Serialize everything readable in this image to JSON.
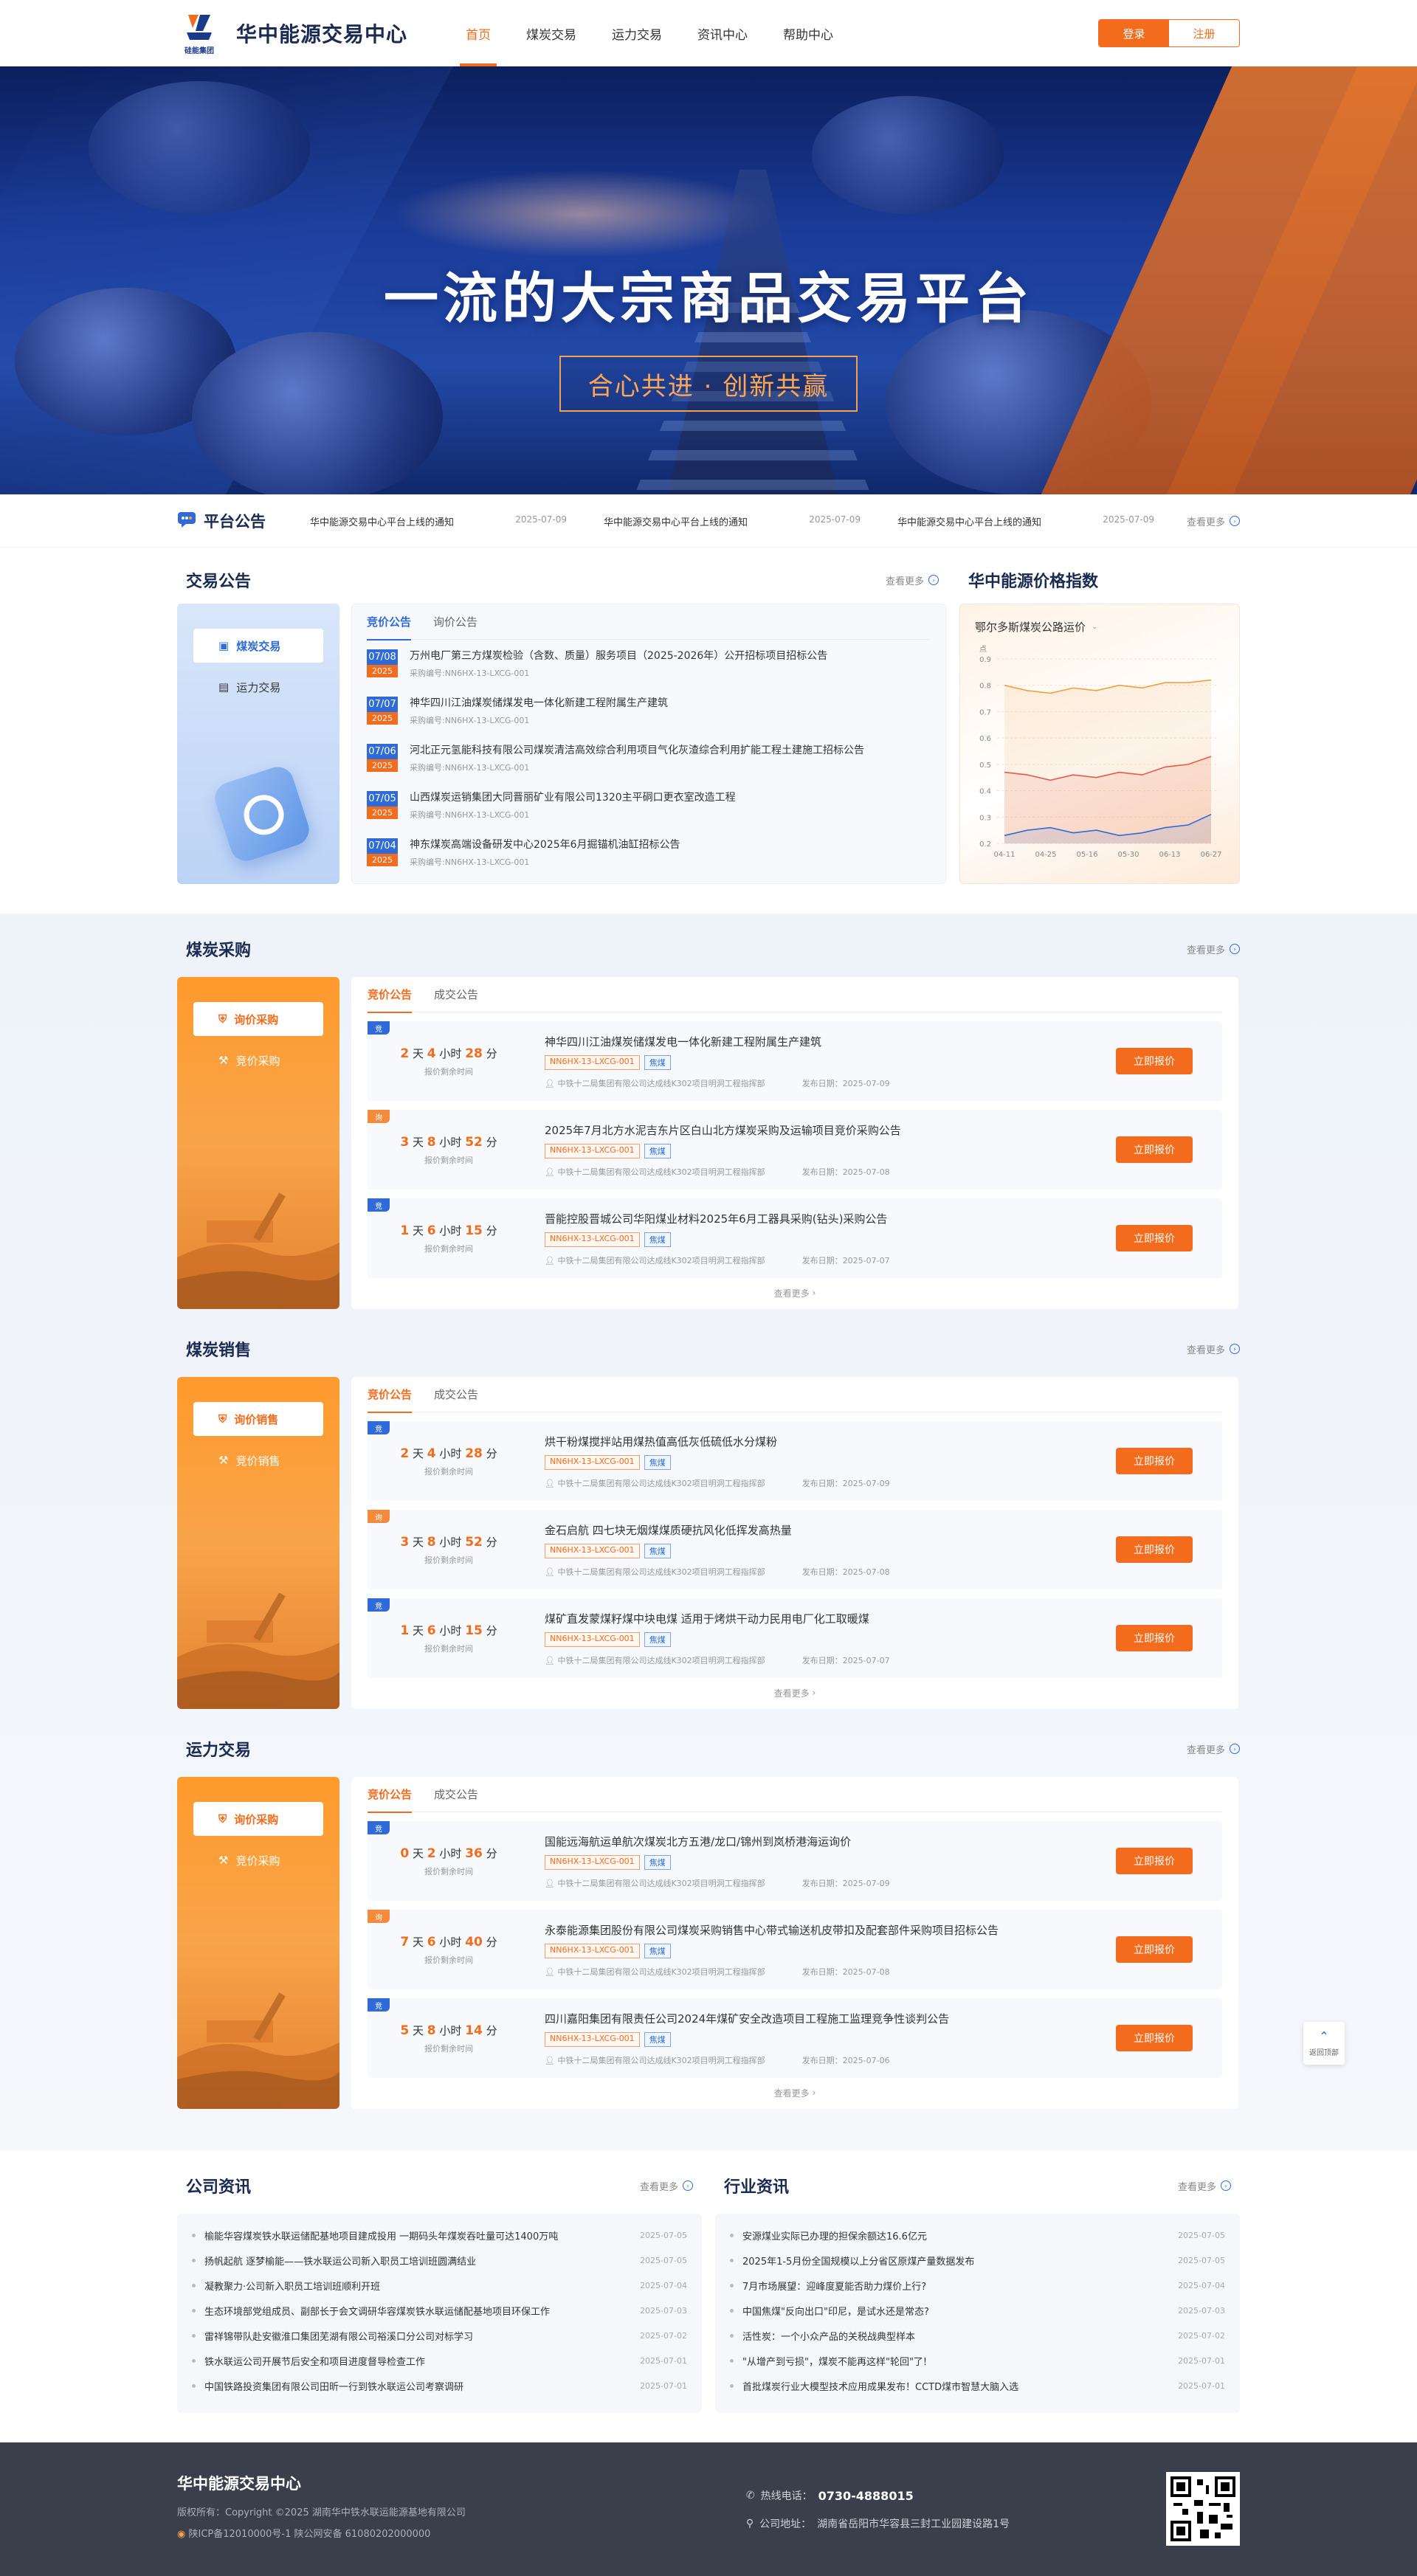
{
  "header": {
    "logo_sub": "硅能集团",
    "site_title": "华中能源交易中心",
    "nav": [
      {
        "label": "首页",
        "active": true
      },
      {
        "label": "煤炭交易"
      },
      {
        "label": "运力交易"
      },
      {
        "label": "资讯中心"
      },
      {
        "label": "帮助中心"
      }
    ],
    "login": "登录",
    "register": "注册"
  },
  "banner": {
    "title": "一流的大宗商品交易平台",
    "slogan": "合心共进 · 创新共赢"
  },
  "platform_notice": {
    "title": "平台公告",
    "items": [
      {
        "text": "华中能源交易中心平台上线的通知",
        "date": "2025-07-09"
      },
      {
        "text": "华中能源交易中心平台上线的通知",
        "date": "2025-07-09"
      },
      {
        "text": "华中能源交易中心平台上线的通知",
        "date": "2025-07-09"
      }
    ],
    "more": "查看更多"
  },
  "trade_announce": {
    "title": "交易公告",
    "more": "查看更多",
    "side": [
      "煤炭交易",
      "运力交易"
    ],
    "tabs": [
      "竞价公告",
      "询价公告"
    ],
    "items": [
      {
        "md": "07/08",
        "yr": "2025",
        "title": "万州电厂第三方煤炭检验（含数、质量）服务项目（2025-2026年）公开招标项目招标公告",
        "no": "采购编号:NN6HX-13-LXCG-001"
      },
      {
        "md": "07/07",
        "yr": "2025",
        "title": "神华四川江油煤炭储煤发电一体化新建工程附属生产建筑",
        "no": "采购编号:NN6HX-13-LXCG-001"
      },
      {
        "md": "07/06",
        "yr": "2025",
        "title": "河北正元氢能科技有限公司煤炭清洁高效综合利用项目气化灰渣综合利用扩能工程土建施工招标公告",
        "no": "采购编号:NN6HX-13-LXCG-001"
      },
      {
        "md": "07/05",
        "yr": "2025",
        "title": "山西煤炭运销集团大同晋丽矿业有限公司1320主平硐口更衣室改造工程",
        "no": "采购编号:NN6HX-13-LXCG-001"
      },
      {
        "md": "07/04",
        "yr": "2025",
        "title": "神东煤炭高端设备研发中心2025年6月掘锚机油缸招标公告",
        "no": "采购编号:NN6HX-13-LXCG-001"
      }
    ]
  },
  "price_index": {
    "title": "华中能源价格指数",
    "select": "鄂尔多斯煤炭公路运价"
  },
  "chart_data": {
    "type": "line",
    "title": "",
    "ylabel": "点",
    "x": [
      "04-11",
      "04-25",
      "05-16",
      "05-30",
      "06-13",
      "06-27"
    ],
    "ylim": [
      0.2,
      0.9
    ],
    "yticks": [
      0.2,
      0.3,
      0.4,
      0.5,
      0.6,
      0.7,
      0.8,
      0.9
    ],
    "series": [
      {
        "color": "#f0a040",
        "values": [
          0.8,
          0.78,
          0.77,
          0.79,
          0.78,
          0.8,
          0.79,
          0.81,
          0.81,
          0.82
        ]
      },
      {
        "color": "#e85a4a",
        "values": [
          0.47,
          0.46,
          0.44,
          0.46,
          0.45,
          0.47,
          0.46,
          0.49,
          0.5,
          0.53
        ]
      },
      {
        "color": "#2f6bd8",
        "values": [
          0.23,
          0.25,
          0.26,
          0.24,
          0.25,
          0.23,
          0.24,
          0.26,
          0.27,
          0.31
        ]
      }
    ]
  },
  "coal_purchase": {
    "title": "煤炭采购",
    "more": "查看更多",
    "side": [
      "询价采购",
      "竞价采购"
    ],
    "tabs": [
      "竞价公告",
      "成交公告"
    ],
    "rows": [
      {
        "flag": "竞",
        "flag_color": "blue",
        "d": "2",
        "h": "4",
        "m": "28",
        "title": "神华四川江油煤炭储煤发电一体化新建工程附属生产建筑",
        "code": "NN6HX-13-LXCG-001",
        "kind": "焦煤",
        "org": "中铁十二局集团有限公司达成线K302项目明洞工程指挥部",
        "date": "发布日期：2025-07-09"
      },
      {
        "flag": "询",
        "flag_color": "orange",
        "d": "3",
        "h": "8",
        "m": "52",
        "title": "2025年7月北方水泥吉东片区白山北方煤炭采购及运输项目竞价采购公告",
        "code": "NN6HX-13-LXCG-001",
        "kind": "焦煤",
        "org": "中铁十二局集团有限公司达成线K302项目明洞工程指挥部",
        "date": "发布日期：2025-07-08"
      },
      {
        "flag": "竞",
        "flag_color": "blue",
        "d": "1",
        "h": "6",
        "m": "15",
        "title": "晋能控股晋城公司华阳煤业材料2025年6月工器具采购(钻头)采购公告",
        "code": "NN6HX-13-LXCG-001",
        "kind": "焦煤",
        "org": "中铁十二局集团有限公司达成线K302项目明洞工程指挥部",
        "date": "发布日期：2025-07-07"
      }
    ]
  },
  "coal_sale": {
    "title": "煤炭销售",
    "more": "查看更多",
    "side": [
      "询价销售",
      "竞价销售"
    ],
    "tabs": [
      "竞价公告",
      "成交公告"
    ],
    "rows": [
      {
        "flag": "竞",
        "flag_color": "blue",
        "d": "2",
        "h": "4",
        "m": "28",
        "title": "烘干粉煤搅拌站用煤热值高低灰低硫低水分煤粉",
        "code": "NN6HX-13-LXCG-001",
        "kind": "焦煤",
        "org": "中铁十二局集团有限公司达成线K302项目明洞工程指挥部",
        "date": "发布日期：2025-07-09"
      },
      {
        "flag": "询",
        "flag_color": "orange",
        "d": "3",
        "h": "8",
        "m": "52",
        "title": "金石启航 四七块无烟煤煤质硬抗风化低挥发高热量",
        "code": "NN6HX-13-LXCG-001",
        "kind": "焦煤",
        "org": "中铁十二局集团有限公司达成线K302项目明洞工程指挥部",
        "date": "发布日期：2025-07-08"
      },
      {
        "flag": "竞",
        "flag_color": "blue",
        "d": "1",
        "h": "6",
        "m": "15",
        "title": "煤矿直发蒙煤籽煤中块电煤 适用于烤烘干动力民用电厂化工取暖煤",
        "code": "NN6HX-13-LXCG-001",
        "kind": "焦煤",
        "org": "中铁十二局集团有限公司达成线K302项目明洞工程指挥部",
        "date": "发布日期：2025-07-07"
      }
    ]
  },
  "capacity": {
    "title": "运力交易",
    "more": "查看更多",
    "side": [
      "询价采购",
      "竞价采购"
    ],
    "tabs": [
      "竞价公告",
      "成交公告"
    ],
    "rows": [
      {
        "flag": "竞",
        "flag_color": "blue",
        "d": "0",
        "h": "2",
        "m": "36",
        "title": "国能远海航运单航次煤炭北方五港/龙口/锦州到岚桥港海运询价",
        "code": "NN6HX-13-LXCG-001",
        "kind": "焦煤",
        "org": "中铁十二局集团有限公司达成线K302项目明洞工程指挥部",
        "date": "发布日期：2025-07-09"
      },
      {
        "flag": "询",
        "flag_color": "orange",
        "d": "7",
        "h": "6",
        "m": "40",
        "title": "永泰能源集团股份有限公司煤炭采购销售中心带式输送机皮带扣及配套部件采购项目招标公告",
        "code": "NN6HX-13-LXCG-001",
        "kind": "焦煤",
        "org": "中铁十二局集团有限公司达成线K302项目明洞工程指挥部",
        "date": "发布日期：2025-07-08"
      },
      {
        "flag": "竞",
        "flag_color": "blue",
        "d": "5",
        "h": "8",
        "m": "14",
        "title": "四川嘉阳集团有限责任公司2024年煤矿安全改造项目工程施工监理竞争性谈判公告",
        "code": "NN6HX-13-LXCG-001",
        "kind": "焦煤",
        "org": "中铁十二局集团有限公司达成线K302项目明洞工程指挥部",
        "date": "发布日期：2025-07-06"
      }
    ]
  },
  "trade_labels": {
    "day": "天",
    "hour": "小时",
    "min": "分",
    "remain": "报价剩余时间",
    "quote": "立即报价",
    "view_more": "查看更多"
  },
  "company_news": {
    "title": "公司资讯",
    "more": "查看更多",
    "items": [
      {
        "t": "榆能华容煤炭铁水联运储配基地项目建成投用 一期码头年煤炭吞吐量可达1400万吨",
        "d": "2025-07-05"
      },
      {
        "t": "扬帆起航 逐梦榆能——铁水联运公司新入职员工培训班圆满结业",
        "d": "2025-07-05"
      },
      {
        "t": "凝教聚力·公司新入职员工培训班顺利开班",
        "d": "2025-07-04"
      },
      {
        "t": "生态环境部党组成员、副部长于会文调研华容煤炭铁水联运储配基地项目环保工作",
        "d": "2025-07-03"
      },
      {
        "t": "雷祥锦带队赴安徽淮口集团芜湖有限公司裕溪口分公司对标学习",
        "d": "2025-07-02"
      },
      {
        "t": "铁水联运公司开展节后安全和项目进度督导检查工作",
        "d": "2025-07-01"
      },
      {
        "t": "中国铁路投资集团有限公司田昕一行到铁水联运公司考察调研",
        "d": "2025-07-01"
      }
    ]
  },
  "industry_news": {
    "title": "行业资讯",
    "more": "查看更多",
    "items": [
      {
        "t": "安源煤业实际已办理的担保余额达16.6亿元",
        "d": "2025-07-05"
      },
      {
        "t": "2025年1-5月份全国规模以上分省区原煤产量数据发布",
        "d": "2025-07-05"
      },
      {
        "t": "7月市场展望：迎峰度夏能否助力煤价上行?",
        "d": "2025-07-04"
      },
      {
        "t": "中国焦煤\"反向出口\"印尼，是试水还是常态?",
        "d": "2025-07-03"
      },
      {
        "t": "活性炭：一个小众产品的关税战典型样本",
        "d": "2025-07-02"
      },
      {
        "t": "\"从增产到亏损\"，煤炭不能再这样\"轮回\"了!",
        "d": "2025-07-01"
      },
      {
        "t": "首批煤炭行业大模型技术应用成果发布！CCTD煤市智慧大脑入选",
        "d": "2025-07-01"
      }
    ]
  },
  "footer": {
    "name": "华中能源交易中心",
    "copyright": "版权所有：Copyright ©2025 湖南华中铁水联运能源基地有限公司",
    "icp": "陕ICP备12010000号-1  陕公网安备 61080202000000",
    "hotline_label": "热线电话：",
    "hotline": "0730-4888015",
    "address_label": "公司地址：",
    "address": "湖南省岳阳市华容县三封工业园建设路1号"
  },
  "backtop": "返回顶部"
}
